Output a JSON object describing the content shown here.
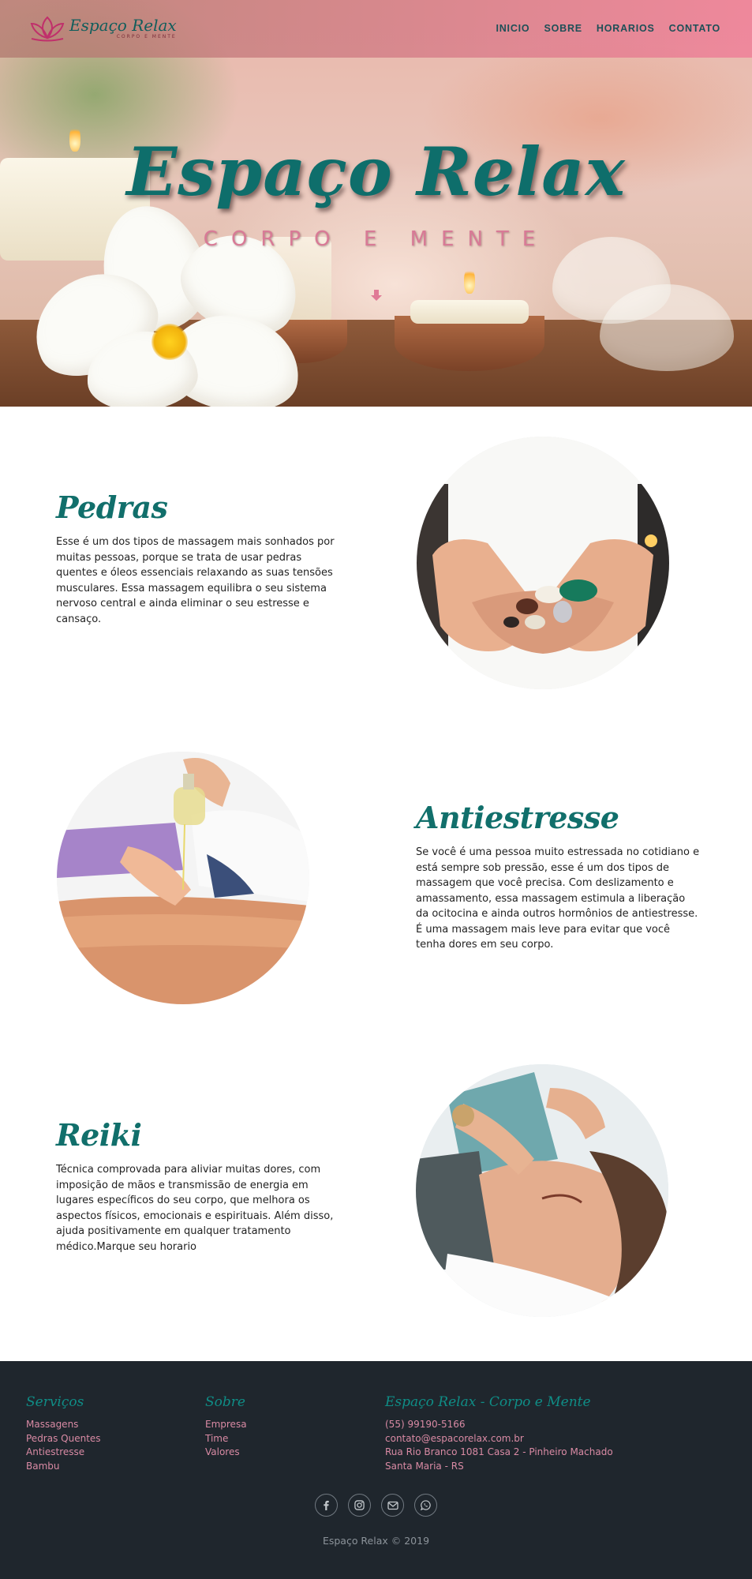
{
  "header": {
    "logo_title": "Espaço Relax",
    "logo_subtitle": "CORPO E MENTE",
    "nav": [
      "INICIO",
      "SOBRE",
      "HORARIOS",
      "CONTATO"
    ]
  },
  "hero": {
    "title": "Espaço Relax",
    "subtitle": "CORPO E MENTE"
  },
  "services": [
    {
      "title": "Pedras",
      "text": "Esse é um dos tipos de massagem mais sonhados por muitas pessoas, porque se trata de usar pedras quentes e óleos essenciais relaxando as suas tensões musculares. Essa massagem equilibra o seu sistema nervoso central e ainda eliminar o seu estresse e cansaço."
    },
    {
      "title": "Antiestresse",
      "text": "Se você é uma pessoa muito estressada no cotidiano e está sempre sob pressão, esse é um dos tipos de massagem que você precisa. Com deslizamento e amassamento, essa massagem estimula a liberação da ocitocina e ainda outros hormônios de antiestresse. É uma massagem mais leve para evitar que você tenha dores em seu corpo."
    },
    {
      "title": "Reiki",
      "text": "Técnica comprovada para aliviar muitas dores, com imposição de mãos e transmissão de energia em lugares específicos do seu corpo, que melhora os aspectos físicos, emocionais e espirituais. Além disso, ajuda positivamente em qualquer tratamento médico.Marque seu horario"
    }
  ],
  "footer": {
    "col1": {
      "title": "Serviços",
      "items": [
        "Massagens",
        "Pedras Quentes",
        "Antiestresse",
        "Bambu"
      ]
    },
    "col2": {
      "title": "Sobre",
      "items": [
        "Empresa",
        "Time",
        "Valores"
      ]
    },
    "col3": {
      "title": "Espaço Relax - Corpo e Mente",
      "items": [
        "(55) 99190-5166",
        "contato@espacorelax.com.br",
        "Rua Rio Branco 1081 Casa 2 - Pinheiro Machado",
        "Santa Maria - RS"
      ]
    },
    "social_icons": [
      "facebook-icon",
      "instagram-icon",
      "email-icon",
      "whatsapp-icon"
    ],
    "copyright": "Espaço Relax © 2019"
  },
  "colors": {
    "brand_teal": "#116f6b",
    "accent_pink": "#d98aa4",
    "footer_bg": "#1f262d"
  }
}
